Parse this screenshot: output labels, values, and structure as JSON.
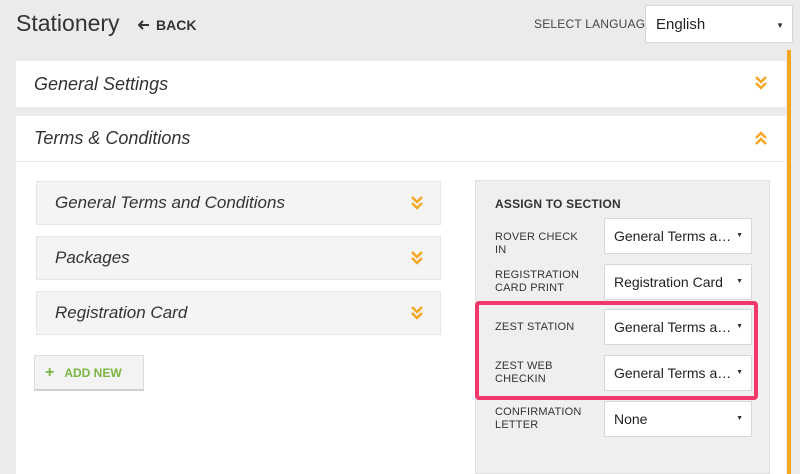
{
  "header": {
    "title": "Stationery",
    "back_label": "BACK",
    "language_label": "SELECT LANGUAGE",
    "language_value": "English"
  },
  "panels": {
    "general_settings": {
      "title": "General Settings"
    },
    "terms": {
      "title": "Terms & Conditions"
    }
  },
  "items": [
    {
      "label": "General Terms and Conditions"
    },
    {
      "label": "Packages"
    },
    {
      "label": "Registration Card"
    }
  ],
  "add_new_label": "ADD NEW",
  "assign": {
    "title": "ASSIGN TO SECTION",
    "rows": [
      {
        "label": "ROVER CHECK IN",
        "value": "General Terms and Conditions"
      },
      {
        "label": "REGISTRATION CARD PRINT",
        "value": "Registration Card"
      },
      {
        "label": "ZEST STATION",
        "value": "General Terms and Conditions"
      },
      {
        "label": "ZEST WEB CHECKIN",
        "value": "General Terms and Conditions"
      },
      {
        "label": "CONFIRMATION LETTER",
        "value": "None"
      }
    ]
  },
  "colors": {
    "accent": "#f5a623",
    "add_new": "#7cb342",
    "highlight": "#f0386b"
  },
  "icons": {
    "back": "arrow-left-icon",
    "expand": "double-chevron-down-icon",
    "collapse": "double-chevron-up-icon",
    "dropdown": "caret-down-icon",
    "add": "plus-icon"
  }
}
